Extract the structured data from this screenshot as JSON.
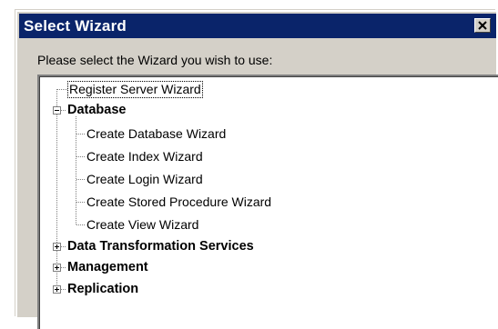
{
  "dialog": {
    "title": "Select Wizard",
    "prompt": "Please select the Wizard you wish to use:"
  },
  "tree": {
    "register": "Register Server Wizard",
    "database": {
      "label": "Database",
      "children": [
        "Create Database Wizard",
        "Create Index Wizard",
        "Create Login Wizard",
        "Create Stored Procedure Wizard",
        "Create View Wizard"
      ]
    },
    "dts": "Data Transformation Services",
    "management": "Management",
    "replication": "Replication"
  },
  "icons": {
    "close": "close-icon",
    "expand": "plus-icon",
    "collapse": "minus-icon"
  },
  "colors": {
    "titlebar": "#0a246a",
    "face": "#d4d0c8"
  }
}
